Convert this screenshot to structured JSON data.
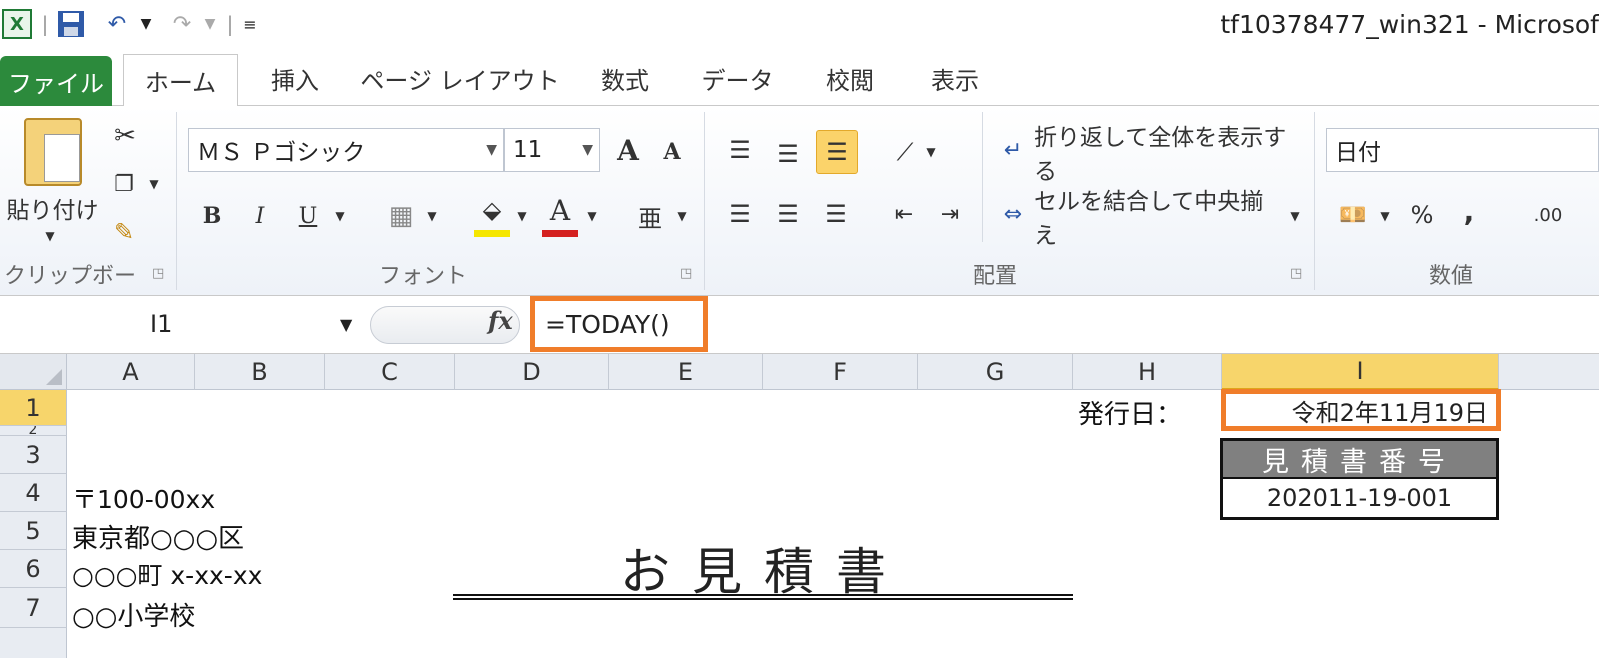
{
  "window": {
    "title": "tf10378477_win321 - Microsof"
  },
  "quick_access": {
    "excel_icon": "excel-icon",
    "save_icon": "save-icon",
    "undo_icon": "undo-icon",
    "redo_icon": "redo-icon",
    "customize_icon": "customize-icon"
  },
  "tabs": [
    {
      "label": "ファイル"
    },
    {
      "label": "ホーム"
    },
    {
      "label": "挿入"
    },
    {
      "label": "ページ レイアウト"
    },
    {
      "label": "数式"
    },
    {
      "label": "データ"
    },
    {
      "label": "校閲"
    },
    {
      "label": "表示"
    }
  ],
  "ribbon": {
    "clipboard": {
      "paste_label": "貼り付け",
      "group_label": "クリップボード"
    },
    "font": {
      "font_name": "ＭＳ Ｐゴシック",
      "font_size": "11",
      "bold": "B",
      "italic": "I",
      "underline": "U",
      "font_color_glyph": "A",
      "grow_glyph": "A",
      "shrink_glyph": "A",
      "group_label": "フォント",
      "fill_color": "#f5e600",
      "font_color": "#d42020"
    },
    "alignment": {
      "wrap_text": "折り返して全体を表示する",
      "merge_center": "セルを結合して中央揃え",
      "group_label": "配置"
    },
    "number": {
      "format": "日付",
      "percent": "%",
      "comma": ",",
      "increase_decimal": ".00",
      "group_label": "数値"
    }
  },
  "formula_bar": {
    "name_box": "I1",
    "fx_label": "fx",
    "formula": "=TODAY()"
  },
  "sheet": {
    "columns": [
      "A",
      "B",
      "C",
      "D",
      "E",
      "F",
      "G",
      "H",
      "I"
    ],
    "rows": [
      "1",
      "2",
      "3",
      "4",
      "5",
      "6",
      "7"
    ],
    "issue_label": "発行日：",
    "issue_date": "令和2年11月19日",
    "quote_number_header": "見積書番号",
    "quote_number": "202011-19-001",
    "address": [
      "〒100-00xx",
      "東京都○○○区",
      "○○○町 x-xx-xx",
      "○○小学校"
    ],
    "document_title": "お見積書"
  },
  "colors": {
    "highlight": "#f07d2a",
    "file_tab": "#2c8a3c",
    "selected_header": "#f7d56b"
  }
}
